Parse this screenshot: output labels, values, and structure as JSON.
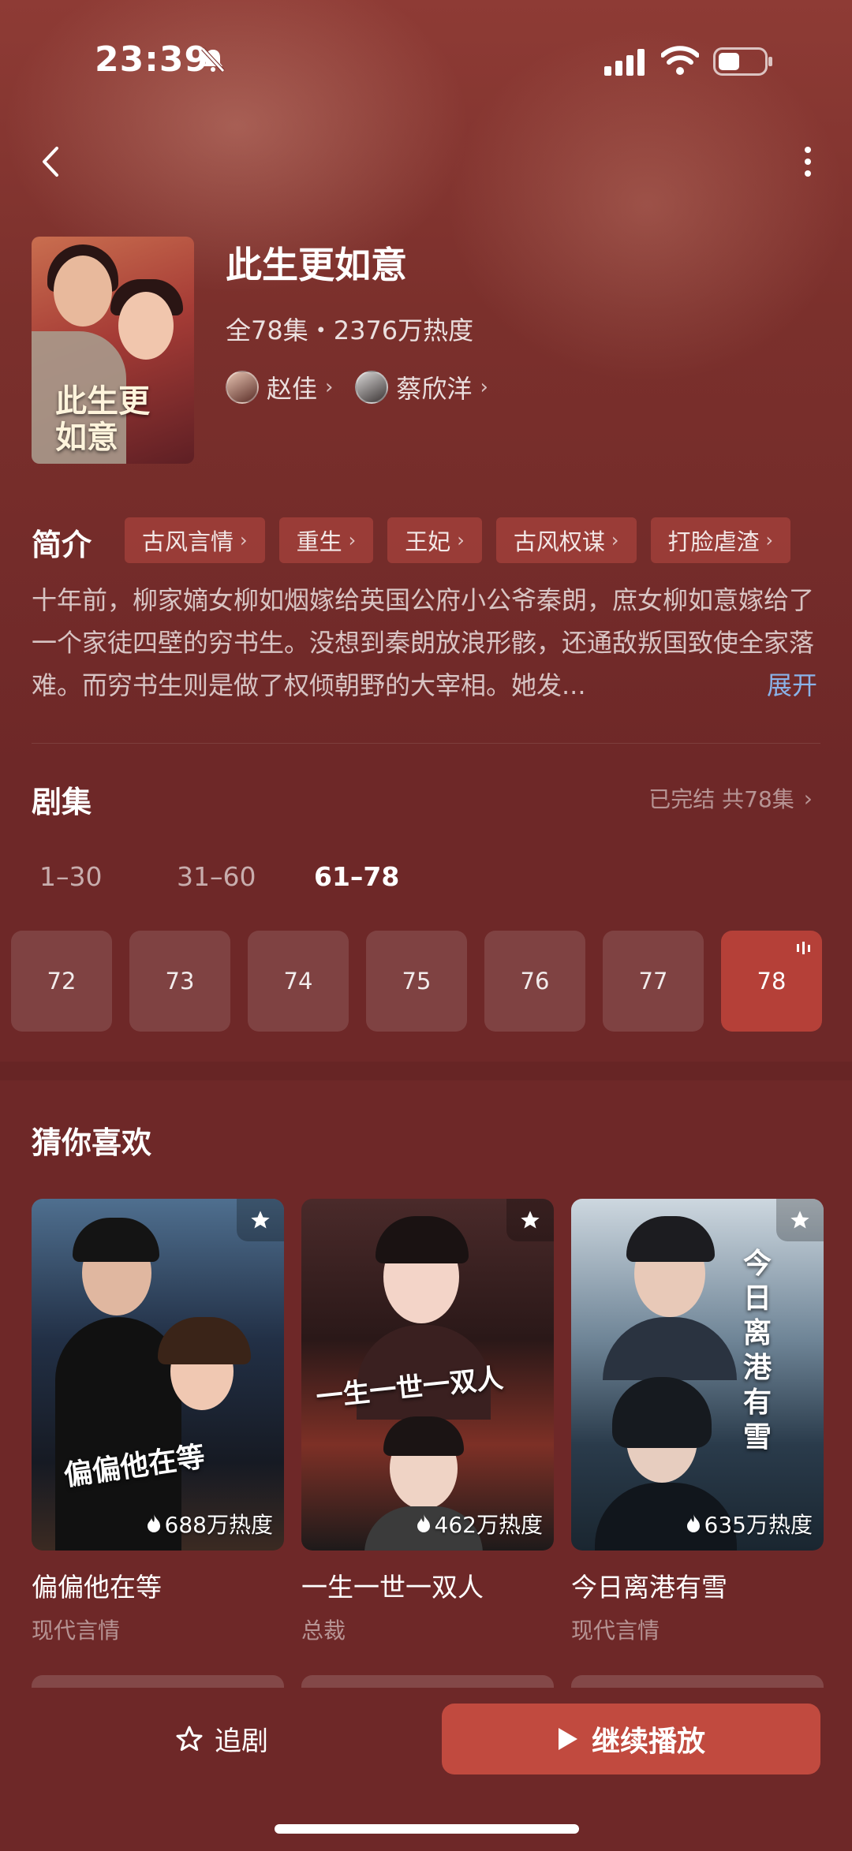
{
  "status_bar": {
    "time": "23:39"
  },
  "show": {
    "title": "此生更如意",
    "poster_title": "此生更如意",
    "meta": "全78集・2376万热度",
    "cast": [
      {
        "name": "赵佳"
      },
      {
        "name": "蔡欣洋"
      }
    ]
  },
  "intro": {
    "label": "简介",
    "tags": [
      "古风言情",
      "重生",
      "王妃",
      "古风权谋",
      "打脸虐渣"
    ],
    "synopsis": "十年前，柳家嫡女柳如烟嫁给英国公府小公爷秦朗，庶女柳如意嫁给了一个家徒四壁的穷书生。没想到秦朗放浪形骸，还通敌叛国致使全家落难。而穷书生则是做了权倾朝野的大宰相。她发...",
    "expand_label": "展开"
  },
  "episodes": {
    "title": "剧集",
    "status": "已完结 共78集",
    "ranges": [
      {
        "label": "1–30",
        "active": false
      },
      {
        "label": "31–60",
        "active": false
      },
      {
        "label": "61–78",
        "active": true
      }
    ],
    "items": [
      "72",
      "73",
      "74",
      "75",
      "76",
      "77",
      "78"
    ],
    "current": "78"
  },
  "recommend": {
    "title": "猜你喜欢",
    "cards": [
      {
        "name": "偏偏他在等",
        "genre": "现代言情",
        "heat": "688万热度",
        "cover_text": "偏偏他在等"
      },
      {
        "name": "一生一世一双人",
        "genre": "总裁",
        "heat": "462万热度",
        "cover_text": "一生一世一双人"
      },
      {
        "name": "今日离港有雪",
        "genre": "现代言情",
        "heat": "635万热度",
        "cover_text": "今日离港有雪"
      }
    ]
  },
  "bottom_bar": {
    "follow_label": "追剧",
    "play_label": "继续播放"
  },
  "colors": {
    "background": "#6e2828",
    "accent": "#c14a3f",
    "link": "#8ab2e8"
  }
}
